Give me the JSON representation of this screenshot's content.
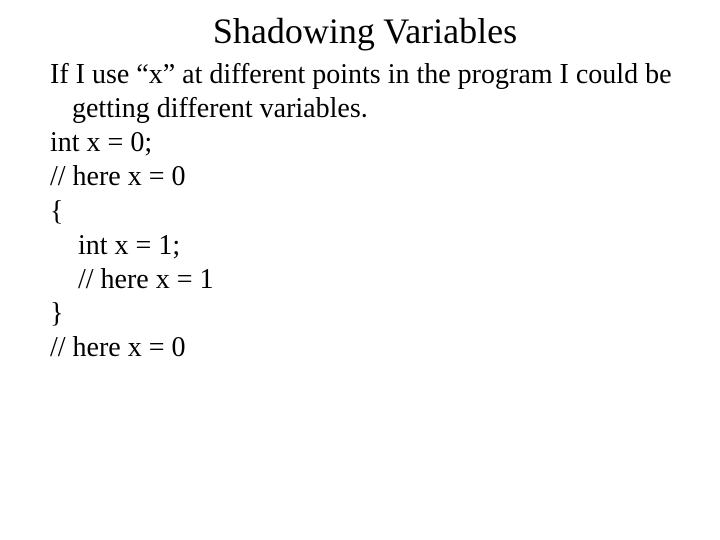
{
  "title": "Shadowing Variables",
  "intro": "If I use “x” at different points in the program I could be getting different variables.",
  "code": {
    "l1": "int x = 0;",
    "l2": "// here x = 0",
    "l3": "{",
    "l4": "int x = 1;",
    "l5": "// here x = 1",
    "l6": "}",
    "l7": "// here x = 0"
  }
}
